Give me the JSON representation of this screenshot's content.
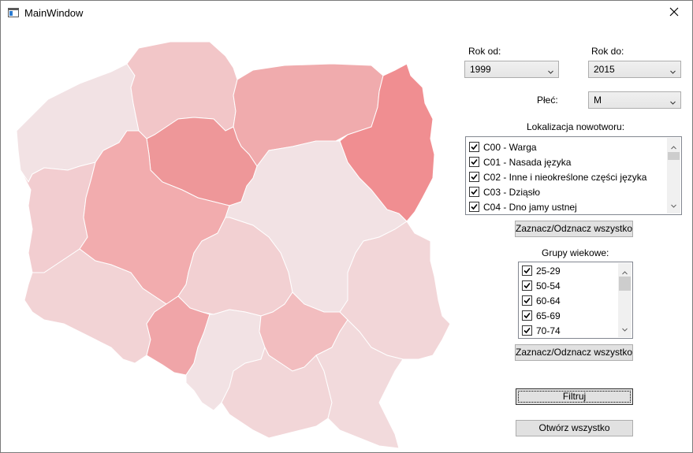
{
  "window": {
    "title": "MainWindow"
  },
  "filters": {
    "year_from_label": "Rok od:",
    "year_from_value": "1999",
    "year_to_label": "Rok do:",
    "year_to_value": "2015",
    "sex_label": "Płeć:",
    "sex_value": "M",
    "tumor_location_label": "Lokalizacja nowotworu:",
    "tumor_locations": [
      {
        "label": "C00 - Warga",
        "checked": true
      },
      {
        "label": "C01 - Nasada języka",
        "checked": true
      },
      {
        "label": "C02 - Inne i nieokreślone części języka",
        "checked": true
      },
      {
        "label": "C03 - Dziąsło",
        "checked": true
      },
      {
        "label": "C04 - Dno jamy ustnej",
        "checked": true
      }
    ],
    "toggle_all_locations_label": "Zaznacz/Odznacz wszystko",
    "age_groups_label": "Grupy wiekowe:",
    "age_groups": [
      {
        "label": "25-29",
        "checked": true
      },
      {
        "label": "50-54",
        "checked": true
      },
      {
        "label": "60-64",
        "checked": true
      },
      {
        "label": "65-69",
        "checked": true
      },
      {
        "label": "70-74",
        "checked": true
      }
    ],
    "toggle_all_ages_label": "Zaznacz/Odznacz wszystko",
    "filter_button_label": "Filtruj",
    "open_all_button_label": "Otwórz wszystko"
  },
  "map": {
    "regions": [
      {
        "name": "zachodniopomorskie",
        "fill": "#f2e2e4"
      },
      {
        "name": "pomorskie",
        "fill": "#f2c6c8"
      },
      {
        "name": "warminsko-mazurskie",
        "fill": "#f0abad"
      },
      {
        "name": "podlaskie",
        "fill": "#f08e91"
      },
      {
        "name": "kujawsko-pomorskie",
        "fill": "#ee9799"
      },
      {
        "name": "lubuskie",
        "fill": "#f2cdd0"
      },
      {
        "name": "wielkopolskie",
        "fill": "#f2acae"
      },
      {
        "name": "mazowieckie",
        "fill": "#f2e2e4"
      },
      {
        "name": "lodzkie",
        "fill": "#f2d0d2"
      },
      {
        "name": "lubelskie",
        "fill": "#f2d6d8"
      },
      {
        "name": "dolnoslaskie",
        "fill": "#f2d3d5"
      },
      {
        "name": "opolskie",
        "fill": "#f0a5a8"
      },
      {
        "name": "slaskie",
        "fill": "#f2e2e4"
      },
      {
        "name": "swietokrzyskie",
        "fill": "#f2bdbf"
      },
      {
        "name": "malopolskie",
        "fill": "#f2d6d8"
      },
      {
        "name": "podkarpackie",
        "fill": "#f2dadc"
      }
    ]
  }
}
